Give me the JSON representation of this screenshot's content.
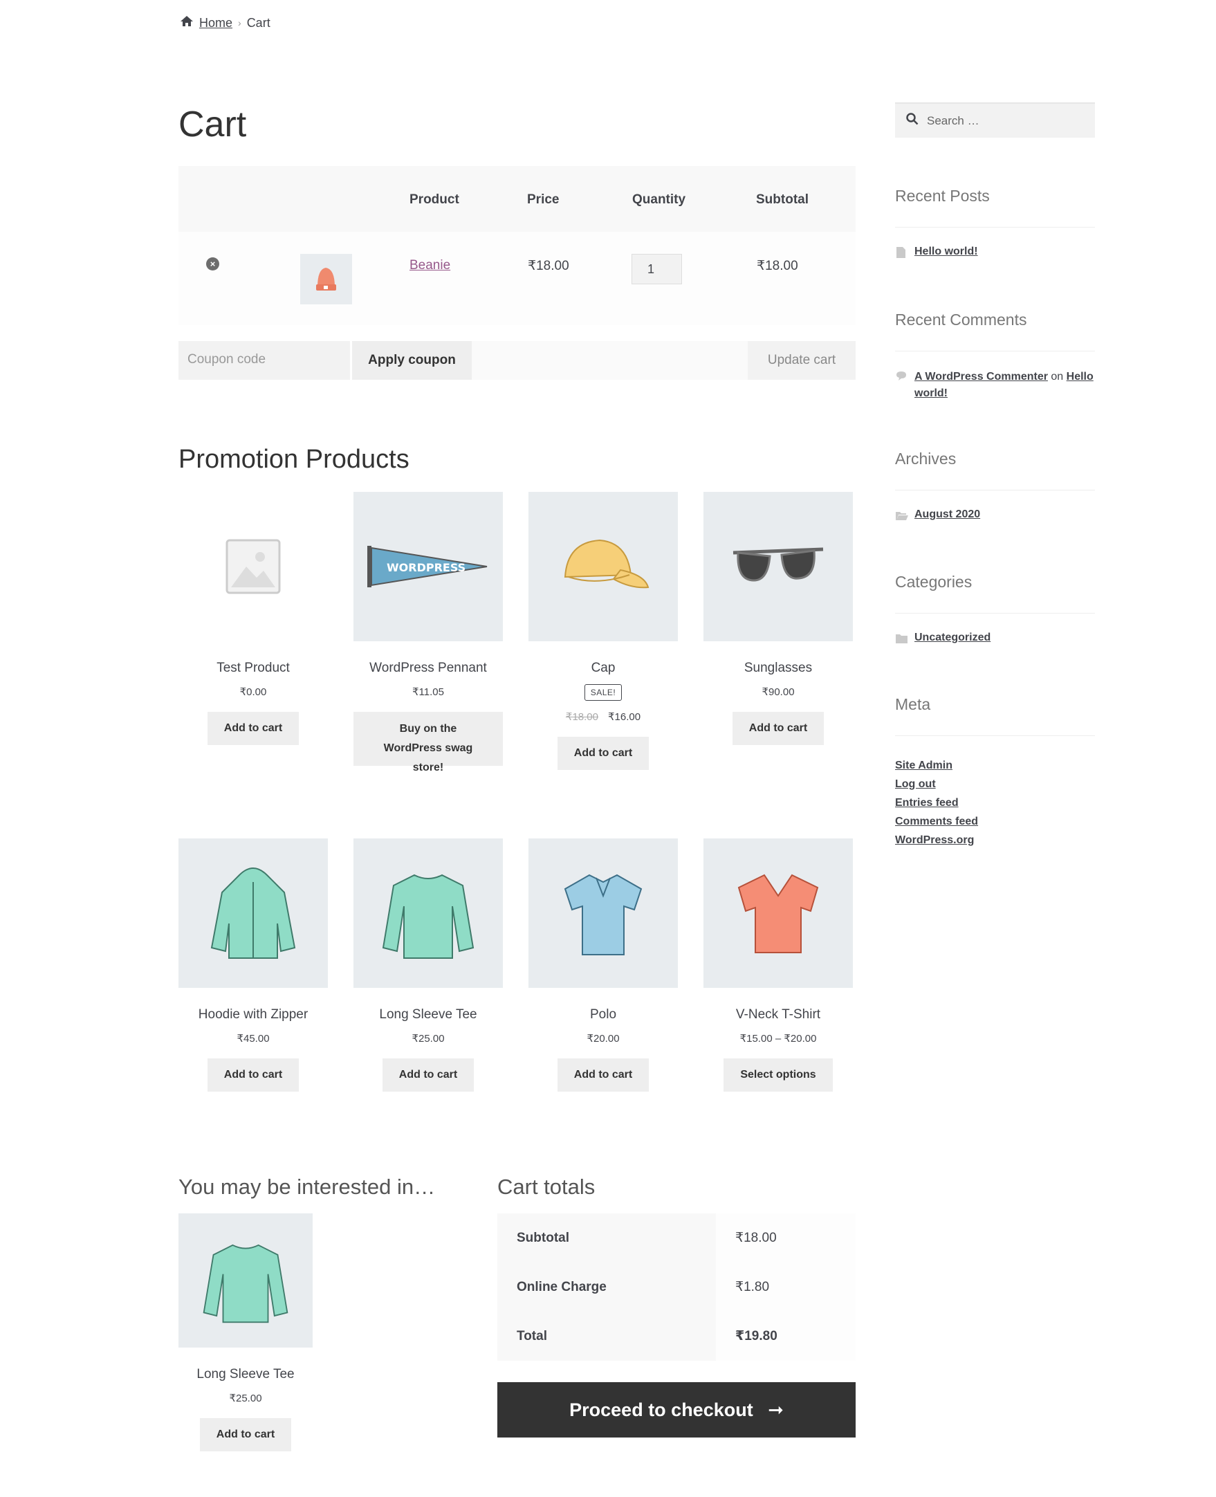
{
  "breadcrumb": {
    "home": "Home",
    "current": "Cart"
  },
  "page_title": "Cart",
  "cart_table": {
    "headers": {
      "product": "Product",
      "price": "Price",
      "quantity": "Quantity",
      "subtotal": "Subtotal"
    },
    "row": {
      "product": "Beanie",
      "price": "₹18.00",
      "quantity": "1",
      "subtotal": "₹18.00"
    }
  },
  "coupon": {
    "placeholder": "Coupon code",
    "apply_label": "Apply coupon",
    "update_label": "Update cart"
  },
  "promotion": {
    "title": "Promotion Products",
    "products": [
      {
        "name": "Test Product",
        "price": "₹0.00",
        "button": "Add to cart"
      },
      {
        "name": "WordPress Pennant",
        "price": "₹11.05",
        "button": "Buy on the WordPress swag store!"
      },
      {
        "name": "Cap",
        "sale_badge": "SALE!",
        "old_price": "₹18.00",
        "price": "₹16.00",
        "button": "Add to cart"
      },
      {
        "name": "Sunglasses",
        "price": "₹90.00",
        "button": "Add to cart"
      },
      {
        "name": "Hoodie with Zipper",
        "price": "₹45.00",
        "button": "Add to cart"
      },
      {
        "name": "Long Sleeve Tee",
        "price": "₹25.00",
        "button": "Add to cart"
      },
      {
        "name": "Polo",
        "price": "₹20.00",
        "button": "Add to cart"
      },
      {
        "name": "V-Neck T-Shirt",
        "price": "₹15.00 – ₹20.00",
        "button": "Select options"
      }
    ]
  },
  "interested": {
    "title": "You may be interested in…",
    "product": {
      "name": "Long Sleeve Tee",
      "price": "₹25.00",
      "button": "Add to cart"
    }
  },
  "totals": {
    "title": "Cart totals",
    "rows": [
      {
        "label": "Subtotal",
        "value": "₹18.00"
      },
      {
        "label": "Online Charge",
        "value": "₹1.80"
      },
      {
        "label": "Total",
        "value": "₹19.80"
      }
    ],
    "checkout_label": "Proceed to checkout"
  },
  "sidebar": {
    "search_placeholder": "Search …",
    "recent_posts": {
      "title": "Recent Posts",
      "items": [
        "Hello world!"
      ]
    },
    "recent_comments": {
      "title": "Recent Comments",
      "author": "A WordPress Commenter",
      "on": "on",
      "post": "Hello world!"
    },
    "archives": {
      "title": "Archives",
      "items": [
        "August 2020"
      ]
    },
    "categories": {
      "title": "Categories",
      "items": [
        "Uncategorized"
      ]
    },
    "meta": {
      "title": "Meta",
      "items": [
        "Site Admin",
        "Log out",
        "Entries feed",
        "Comments feed",
        "WordPress.org"
      ]
    }
  },
  "colors": {
    "link_purple": "#96588a",
    "checkout_bg": "#333333",
    "table_bg": "#f8f8f8",
    "image_bg": "#e8ecef"
  }
}
